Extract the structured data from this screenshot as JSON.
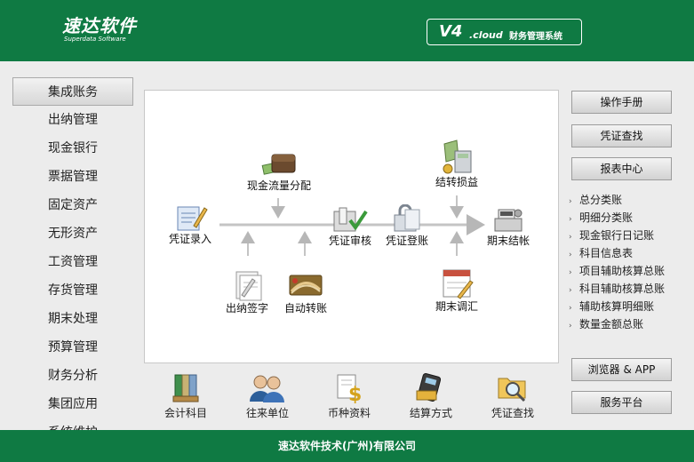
{
  "header": {
    "logo_cn": "速达软件",
    "logo_en": "Superdata Software",
    "version": "V4",
    "version_suffix": ".cloud",
    "system_name": "财务管理系统"
  },
  "left_nav": {
    "items": [
      {
        "label": "集成账务"
      },
      {
        "label": "出纳管理"
      },
      {
        "label": "现金银行"
      },
      {
        "label": "票据管理"
      },
      {
        "label": "固定资产"
      },
      {
        "label": "无形资产"
      },
      {
        "label": "工资管理"
      },
      {
        "label": "存货管理"
      },
      {
        "label": "期末处理"
      },
      {
        "label": "预算管理"
      },
      {
        "label": "财务分析"
      },
      {
        "label": "集团应用"
      },
      {
        "label": "系统维护"
      }
    ]
  },
  "flow": {
    "nodes": {
      "voucher_entry": "凭证录入",
      "cashflow": "现金流量分配",
      "cashier_sign": "出纳签字",
      "auto_transfer": "自动转账",
      "voucher_audit": "凭证审核",
      "voucher_post": "凭证登账",
      "transfer_pl": "结转损益",
      "period_adjust": "期末调汇",
      "period_close": "期末结帐"
    }
  },
  "bottom_tools": {
    "items": [
      {
        "label": "会计科目"
      },
      {
        "label": "往来单位"
      },
      {
        "label": "币种资料"
      },
      {
        "label": "结算方式"
      },
      {
        "label": "凭证查找"
      }
    ]
  },
  "right_panel": {
    "manual": "操作手册",
    "voucher_search": "凭证查找",
    "report_center": "报表中心",
    "reports": [
      {
        "label": "总分类账"
      },
      {
        "label": "明细分类账"
      },
      {
        "label": "现金银行日记账"
      },
      {
        "label": "科目信息表"
      },
      {
        "label": "项目辅助核算总账"
      },
      {
        "label": "科目辅助核算总账"
      },
      {
        "label": "辅助核算明细账"
      },
      {
        "label": "数量金额总账"
      }
    ],
    "browser_app": "浏览器 & APP",
    "service_platform": "服务平台"
  },
  "footer": {
    "company": "速达软件技术(广州)有限公司"
  },
  "colors": {
    "brand_green": "#0f7a43",
    "panel_bg": "#ececec"
  }
}
